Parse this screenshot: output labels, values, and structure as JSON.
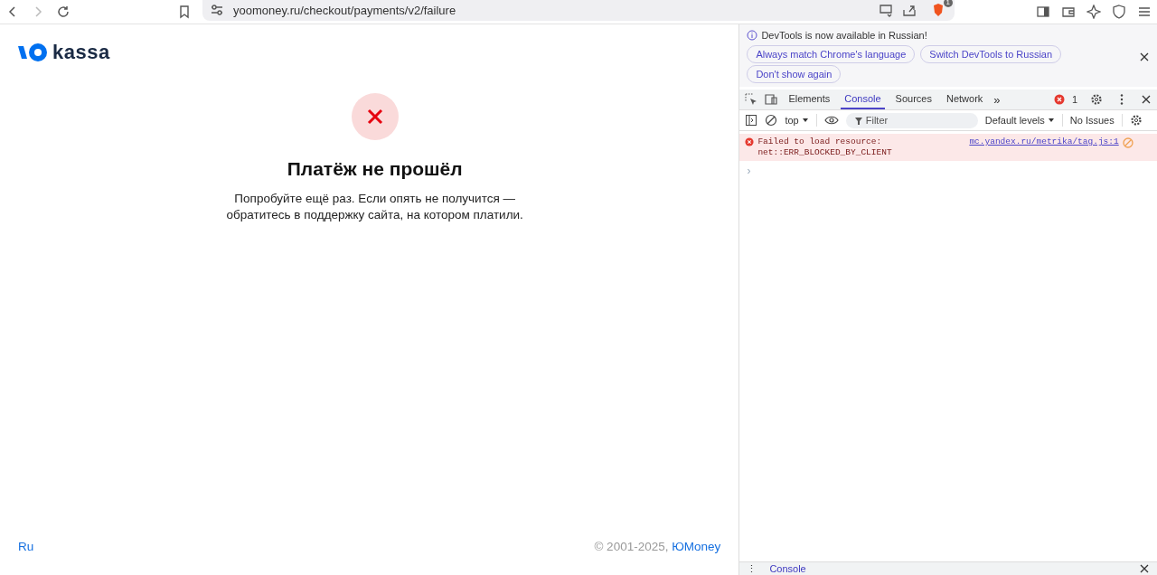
{
  "browser": {
    "url": "yoomoney.ru/checkout/payments/v2/failure",
    "shield_badge": "1"
  },
  "page": {
    "logo_text": "kassa",
    "title": "Платёж не прошёл",
    "message": "Попробуйте ещё раз. Если опять не получится — обратитесь в поддержку сайта, на котором платили.",
    "footer": {
      "language": "Ru",
      "copyright": "© 2001-2025,",
      "brand_link": "ЮMoney"
    }
  },
  "devtools": {
    "banner": {
      "text": "DevTools is now available in Russian!",
      "buttons": [
        "Always match Chrome's language",
        "Switch DevTools to Russian",
        "Don't show again"
      ]
    },
    "tabs": [
      {
        "label": "Elements",
        "selected": false
      },
      {
        "label": "Console",
        "selected": true
      },
      {
        "label": "Sources",
        "selected": false
      },
      {
        "label": "Network",
        "selected": false
      }
    ],
    "more_tabs": "»",
    "error_count": "1",
    "toolbar": {
      "context": "top",
      "filter_placeholder": "Filter",
      "levels": "Default levels",
      "issues": "No Issues"
    },
    "messages": [
      {
        "kind": "error",
        "text": "Failed to load resource: net::ERR_BLOCKED_BY_CLIENT",
        "source": "mc.yandex.ru/metrika/tag.js:1"
      }
    ],
    "prompt": "›",
    "drawer": {
      "menu": "⋮",
      "tab": "Console"
    }
  }
}
